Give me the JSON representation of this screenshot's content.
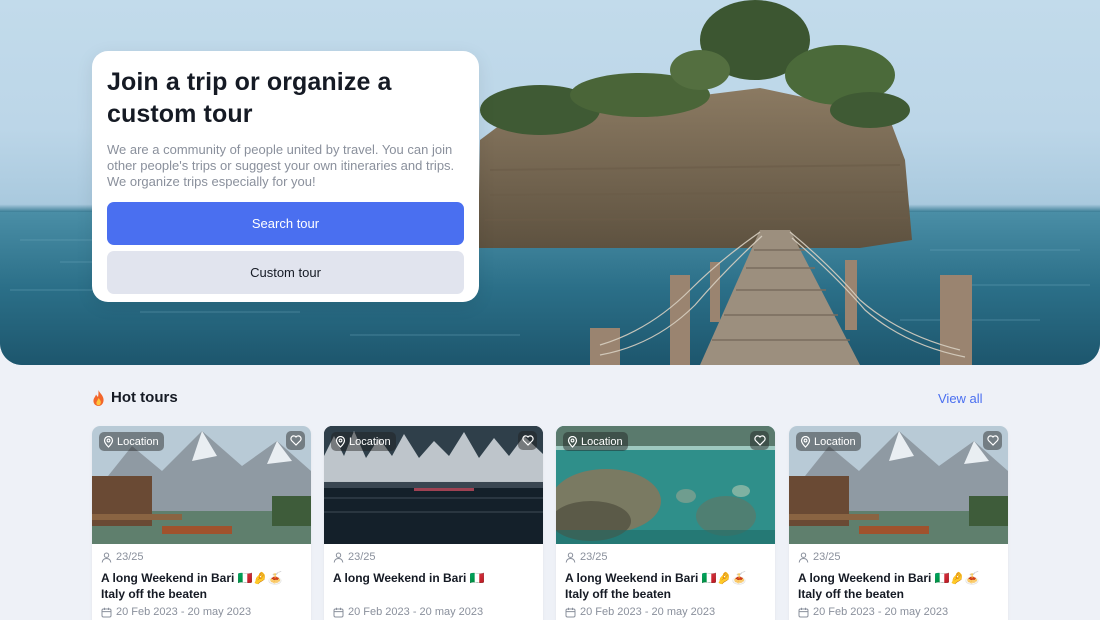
{
  "hero": {
    "title": "Join a trip or organize a custom tour",
    "description": "We are a community of people united by travel. You can join other people's trips or suggest your own itineraries and trips. We organize trips especially for you!",
    "search_button": "Search tour",
    "custom_button": "Custom tour"
  },
  "hot_tours": {
    "title": "Hot tours",
    "view_all": "View all",
    "cards": [
      {
        "location": "Location",
        "seats": "23/25",
        "title": "A long Weekend in Bari 🇮🇹🤌🍝 Italy off the beaten",
        "dates": "20 Feb 2023 - 20 may 2023"
      },
      {
        "location": "Location",
        "seats": "23/25",
        "title": "A long Weekend in Bari 🇮🇹",
        "dates": "20 Feb 2023 - 20 may 2023"
      },
      {
        "location": "Location",
        "seats": "23/25",
        "title": "A long Weekend in Bari 🇮🇹🤌🍝 Italy off the beaten",
        "dates": "20 Feb 2023 - 20 may 2023"
      },
      {
        "location": "Location",
        "seats": "23/25",
        "title": "A long Weekend in Bari 🇮🇹🤌🍝 Italy off the beaten",
        "dates": "20 Feb 2023 - 20 may 2023"
      }
    ]
  },
  "colors": {
    "accent": "#4a6ff0",
    "secondary_button": "#e1e4ee",
    "page_background": "#eef1f7",
    "muted_text": "#8a909c"
  },
  "icons": [
    "fire-icon",
    "location-pin-icon",
    "heart-icon",
    "user-icon",
    "calendar-icon"
  ]
}
